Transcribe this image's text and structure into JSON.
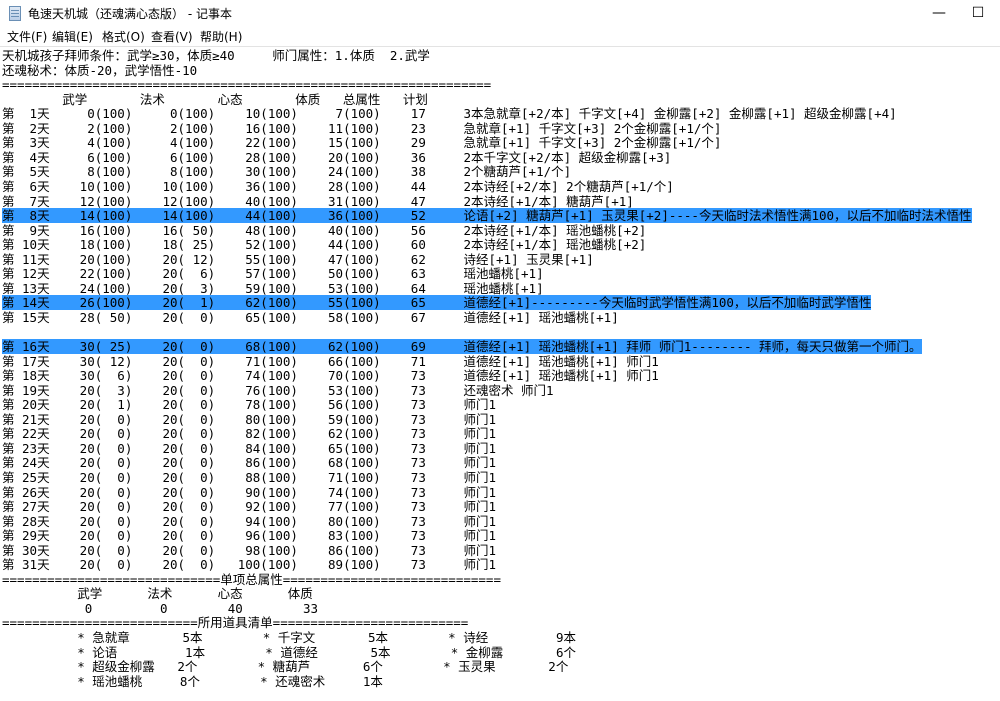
{
  "window": {
    "title": "龟速天机城（还魂满心态版） - 记事本",
    "minimize_symbol": "—",
    "maximize_symbol": "☐"
  },
  "menu": [
    "文件(F)",
    "编辑(E)",
    "格式(O)",
    "查看(V)",
    "帮助(H)"
  ],
  "editor": {
    "lines": [
      "天机城孩子拜师条件：武学≥30，体质≥40     师门属性：1.体质  2.武学",
      "还魂秘术：体质-20，武学悟性-10",
      "=================================================================",
      "        武学       法术       心态       体质   总属性   计划",
      "第  1天     0(100)     0(100)    10(100)     7(100)    17     3本急就章[+2/本] 千字文[+4] 金柳露[+2] 金柳露[+1] 超级金柳露[+4]",
      "第  2天     2(100)     2(100)    16(100)    11(100)    23     急就章[+1] 千字文[+3] 2个金柳露[+1/个]",
      "第  3天     4(100)     4(100)    22(100)    15(100)    29     急就章[+1] 千字文[+3] 2个金柳露[+1/个]",
      "第  4天     6(100)     6(100)    28(100)    20(100)    36     2本千字文[+2/本] 超级金柳露[+3]",
      "第  5天     8(100)     8(100)    30(100)    24(100)    38     2个糖葫芦[+1/个]",
      "第  6天    10(100)    10(100)    36(100)    28(100)    44     2本诗经[+2/本] 2个糖葫芦[+1/个]",
      "第  7天    12(100)    12(100)    40(100)    31(100)    47     2本诗经[+1/本] 糖葫芦[+1]",
      "第  8天    14(100)    14(100)    44(100)    36(100)    52     论语[+2] 糖葫芦[+1] 玉灵果[+2]----今天临时法术悟性满100，以后不加临时法术悟性",
      "第  9天    16(100)    16( 50)    48(100)    40(100)    56     2本诗经[+1/本] 瑶池蟠桃[+2]",
      "第 10天    18(100)    18( 25)    52(100)    44(100)    60     2本诗经[+1/本] 瑶池蟠桃[+2]",
      "第 11天    20(100)    20( 12)    55(100)    47(100)    62     诗经[+1] 玉灵果[+1]",
      "第 12天    22(100)    20(  6)    57(100)    50(100)    63     瑶池蟠桃[+1]",
      "第 13天    24(100)    20(  3)    59(100)    53(100)    64     瑶池蟠桃[+1]",
      "第 14天    26(100)    20(  1)    62(100)    55(100)    65     道德经[+1]---------今天临时武学悟性满100，以后不加临时武学悟性",
      "第 15天    28( 50)    20(  0)    65(100)    58(100)    67     道德经[+1] 瑶池蟠桃[+1]",
      "",
      "第 16天    30( 25)    20(  0)    68(100)    62(100)    69     道德经[+1] 瑶池蟠桃[+1] 拜师 师门1-------- 拜师，每天只做第一个师门。",
      "第 17天    30( 12)    20(  0)    71(100)    66(100)    71     道德经[+1] 瑶池蟠桃[+1] 师门1",
      "第 18天    30(  6)    20(  0)    74(100)    70(100)    73     道德经[+1] 瑶池蟠桃[+1] 师门1",
      "第 19天    20(  3)    20(  0)    76(100)    53(100)    73     还魂密术 师门1",
      "第 20天    20(  1)    20(  0)    78(100)    56(100)    73     师门1",
      "第 21天    20(  0)    20(  0)    80(100)    59(100)    73     师门1",
      "第 22天    20(  0)    20(  0)    82(100)    62(100)    73     师门1",
      "第 23天    20(  0)    20(  0)    84(100)    65(100)    73     师门1",
      "第 24天    20(  0)    20(  0)    86(100)    68(100)    73     师门1",
      "第 25天    20(  0)    20(  0)    88(100)    71(100)    73     师门1",
      "第 26天    20(  0)    20(  0)    90(100)    74(100)    73     师门1",
      "第 27天    20(  0)    20(  0)    92(100)    77(100)    73     师门1",
      "第 28天    20(  0)    20(  0)    94(100)    80(100)    73     师门1",
      "第 29天    20(  0)    20(  0)    96(100)    83(100)    73     师门1",
      "第 30天    20(  0)    20(  0)    98(100)    86(100)    73     师门1",
      "第 31天    20(  0)    20(  0)   100(100)    89(100)    73     师门1",
      "=============================单项总属性=============================",
      "          武学      法术      心态      体质",
      "           0         0        40        33",
      "==========================所用道具清单==========================",
      "          * 急就章       5本        * 千字文       5本        * 诗经         9本",
      "          * 论语         1本        * 道德经       5本        * 金柳露       6个",
      "          * 超级金柳露   2个        * 糖葫芦       6个        * 玉灵果       2个",
      "          * 瑶池蟠桃     8个        * 还魂密术     1本"
    ],
    "selected_line_indexes": [
      11,
      17,
      20
    ]
  }
}
